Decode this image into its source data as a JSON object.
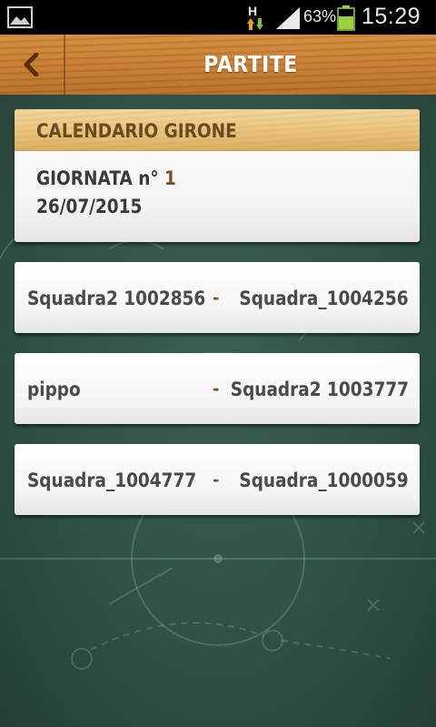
{
  "status_bar": {
    "battery_percent": "63%",
    "time": "15:29",
    "network_type": "H",
    "icons": [
      "image-notification-icon",
      "network-data-icon",
      "signal-icon",
      "battery-icon"
    ]
  },
  "header": {
    "title": "PARTITE",
    "back_icon": "chevron-left-icon"
  },
  "calendar": {
    "title": "CALENDARIO GIRONE",
    "round_label": "GIORNATA n°",
    "round_number": "1",
    "date": "26/07/2015"
  },
  "matches": [
    {
      "home": "Squadra2 1002856",
      "separator": "-",
      "away": "Squadra_1004256"
    },
    {
      "home": "pippo",
      "separator": "-",
      "away": "Squadra2 1003777"
    },
    {
      "home": "Squadra_1004777",
      "separator": "-",
      "away": "Squadra_1000059"
    }
  ],
  "colors": {
    "wood": "#c57a30",
    "card_header": "#e9c27a",
    "board": "#2f5243",
    "accent_text": "#7a4f1f"
  }
}
